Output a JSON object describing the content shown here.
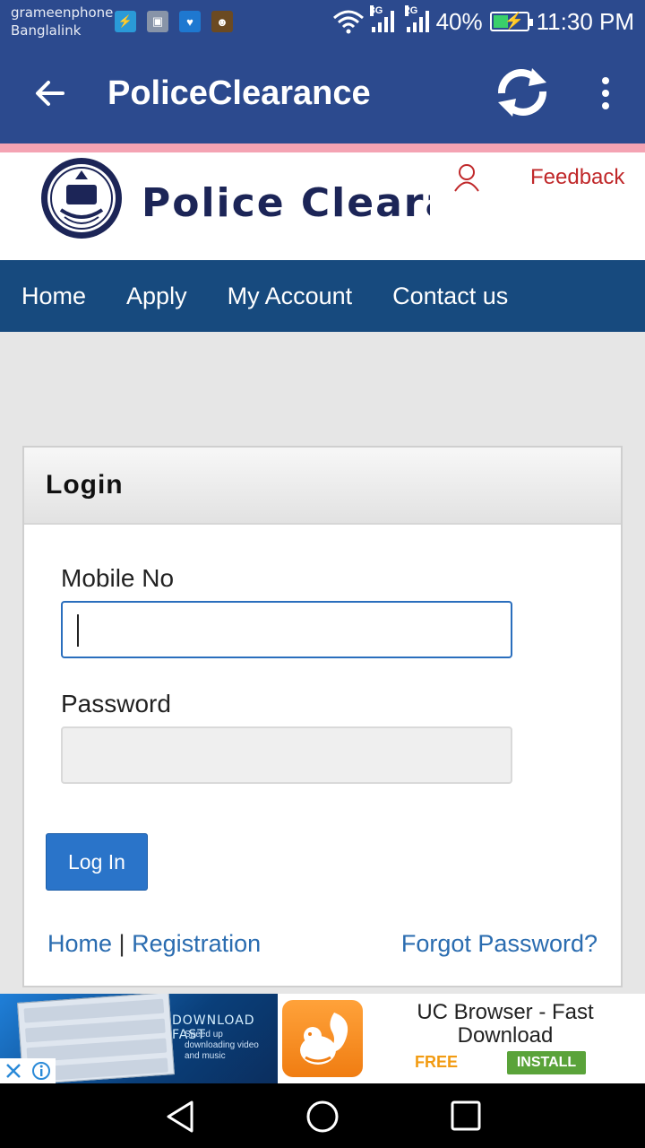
{
  "status_bar": {
    "carrier_1": "grameenphone",
    "carrier_2": "Banglalink",
    "network_1": "3G",
    "network_2": "2G",
    "battery": "40%",
    "time": "11:30 PM"
  },
  "app_bar": {
    "title": "PoliceClearance"
  },
  "site_header": {
    "brand": "Police Clearance",
    "feedback": "Feedback"
  },
  "nav": {
    "items": [
      {
        "label": "Home"
      },
      {
        "label": "Apply"
      },
      {
        "label": "My Account"
      },
      {
        "label": "Contact us"
      }
    ]
  },
  "login": {
    "heading": "Login",
    "mobile_label": "Mobile No",
    "mobile_value": "",
    "password_label": "Password",
    "password_value": "",
    "submit_label": "Log In",
    "home_link": "Home",
    "separator": "|",
    "registration_link": "Registration",
    "forgot_link": "Forgot Password?"
  },
  "ad": {
    "banner_text": "DOWNLOAD FAST",
    "banner_sub": "Speed up downloading video and music",
    "title": "UC Browser - Fast Download",
    "price": "FREE",
    "install": "INSTALL"
  }
}
